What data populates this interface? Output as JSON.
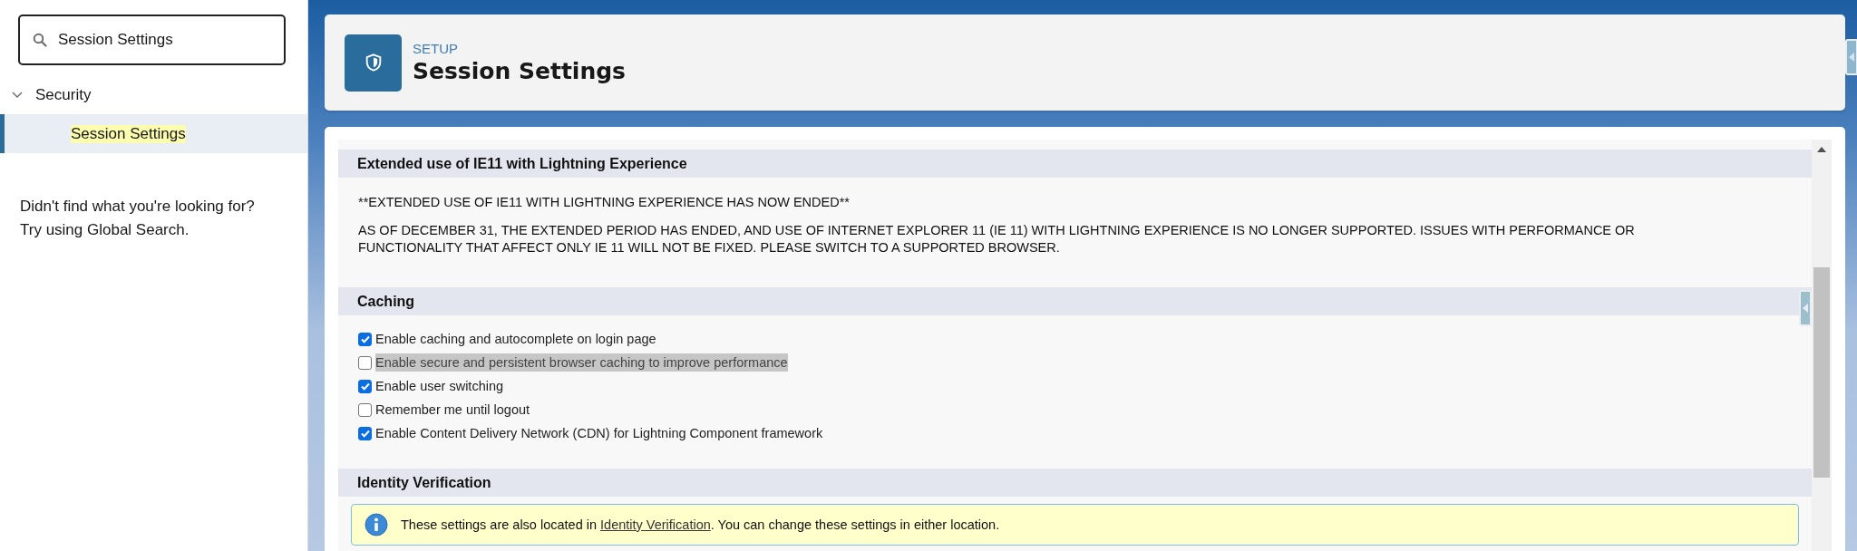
{
  "search": {
    "value": "Session Settings"
  },
  "tree": [
    {
      "label": "Security",
      "expanded": true,
      "children": [
        {
          "label": "Session Settings",
          "selected": true,
          "highlighted": true
        }
      ]
    }
  ],
  "help_text": [
    "Didn't find what you're looking for?",
    "Try using Global Search."
  ],
  "header": {
    "eyebrow": "SETUP",
    "title": "Session Settings"
  },
  "sections": [
    {
      "kind": "notice",
      "title": "Extended use of IE11 with Lightning Experience",
      "paragraphs": [
        "**EXTENDED USE OF IE11 WITH LIGHTNING EXPERIENCE HAS NOW ENDED**",
        "AS OF DECEMBER 31, THE EXTENDED PERIOD HAS ENDED, AND USE OF INTERNET EXPLORER 11 (IE 11) WITH LIGHTNING EXPERIENCE IS NO LONGER SUPPORTED. ISSUES WITH PERFORMANCE OR FUNCTIONALITY THAT AFFECT ONLY IE 11 WILL NOT BE FIXED. PLEASE SWITCH TO A SUPPORTED BROWSER."
      ]
    },
    {
      "kind": "checklist",
      "title": "Caching",
      "items": [
        {
          "label": "Enable caching and autocomplete on login page",
          "checked": true,
          "highlighted": false
        },
        {
          "label": "Enable secure and persistent browser caching to improve performance",
          "checked": false,
          "highlighted": true
        },
        {
          "label": "Enable user switching",
          "checked": true,
          "highlighted": false
        },
        {
          "label": "Remember me until logout",
          "checked": false,
          "highlighted": false
        },
        {
          "label": "Enable Content Delivery Network (CDN) for Lightning Component framework",
          "checked": true,
          "highlighted": false
        }
      ]
    },
    {
      "kind": "info",
      "title": "Identity Verification",
      "message_before": "These settings are also located in ",
      "link": "Identity Verification",
      "message_after": ". You can change these settings in either location."
    }
  ]
}
